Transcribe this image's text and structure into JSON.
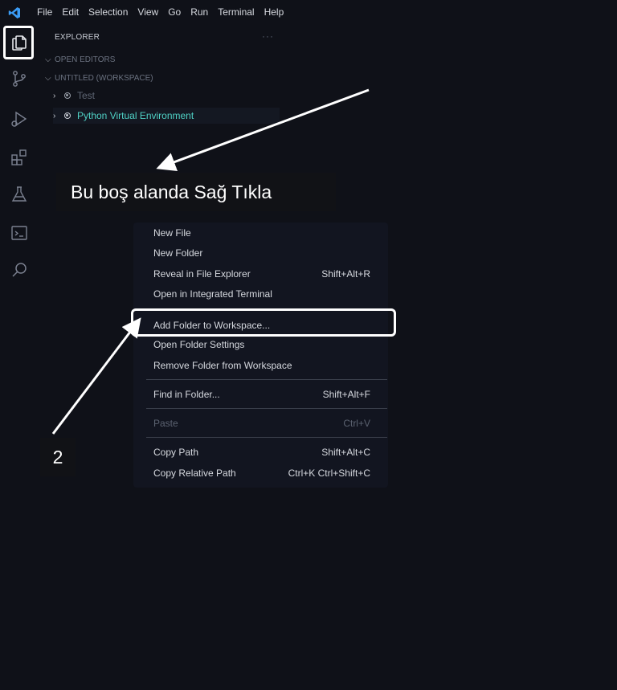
{
  "menubar": {
    "logo": "vscode-logo",
    "items": [
      "File",
      "Edit",
      "Selection",
      "View",
      "Go",
      "Run",
      "Terminal",
      "Help"
    ]
  },
  "activitybar": {
    "icons": [
      "explorer-icon",
      "source-control-icon",
      "run-debug-icon",
      "extensions-icon",
      "testing-icon",
      "terminal-icon",
      "search-icon"
    ]
  },
  "sidebar": {
    "title": "EXPLORER",
    "more": "···",
    "open_editors": "OPEN EDITORS",
    "workspace": "UNTITLED (WORKSPACE)",
    "folders": [
      "Test",
      "Python Virtual Environment"
    ]
  },
  "annotations": {
    "label": "Bu boş alanda Sağ Tıkla",
    "step": "2"
  },
  "context_menu": {
    "groups": [
      [
        {
          "label": "New File",
          "shortcut": ""
        },
        {
          "label": "New Folder",
          "shortcut": ""
        },
        {
          "label": "Reveal in File Explorer",
          "shortcut": "Shift+Alt+R"
        },
        {
          "label": "Open in Integrated Terminal",
          "shortcut": ""
        }
      ],
      [
        {
          "label": "Add Folder to Workspace...",
          "shortcut": ""
        },
        {
          "label": "Open Folder Settings",
          "shortcut": ""
        },
        {
          "label": "Remove Folder from Workspace",
          "shortcut": ""
        }
      ],
      [
        {
          "label": "Find in Folder...",
          "shortcut": "Shift+Alt+F"
        }
      ],
      [
        {
          "label": "Paste",
          "shortcut": "Ctrl+V",
          "disabled": true
        }
      ],
      [
        {
          "label": "Copy Path",
          "shortcut": "Shift+Alt+C"
        },
        {
          "label": "Copy Relative Path",
          "shortcut": "Ctrl+K Ctrl+Shift+C"
        }
      ]
    ]
  },
  "colors": {
    "background": "#0f1118",
    "accent_teal": "#4fd1c5",
    "vscode_blue": "#3b9cf5",
    "highlight_border": "#ffffff"
  }
}
